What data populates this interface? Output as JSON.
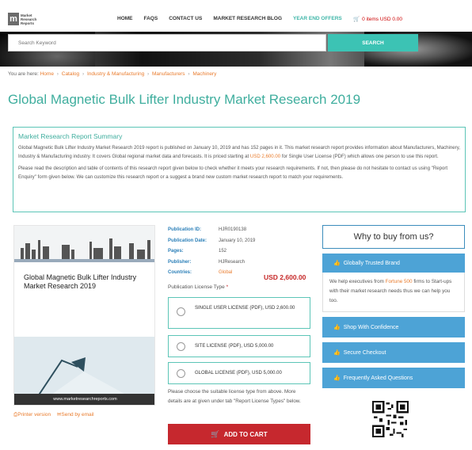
{
  "header": {
    "logo_mark": "m",
    "logo_text_lines": [
      "Market",
      "Research",
      "Reports"
    ],
    "nav": [
      "HOME",
      "FAQS",
      "CONTACT US",
      "MARKET RESEARCH BLOG",
      "YEAR END OFFERS"
    ],
    "cart_label": "0 items USD 0.00"
  },
  "search": {
    "placeholder": "Search Keyword",
    "button_label": "SEARCH"
  },
  "breadcrumb": {
    "prefix": "You are here:",
    "items": [
      "Home",
      "Catalog",
      "Industry & Manufacturing",
      "Manufacturers",
      "Machinery"
    ]
  },
  "page_title": "Global Magnetic Bulk Lifter Industry Market Research 2019",
  "summary": {
    "title": "Market Research Report Summary",
    "para1_a": "Global Magnetic Bulk Lifter Industry Market Research 2019 report is published on January 10, 2019 and has 152 pages in it. This market research report provides information about Manufacturers, Machinery, Industry & Manufacturing industry. It covers Global regional market data and forecasts. It is priced starting at",
    "para1_price": "USD 2,600.00",
    "para1_b": "for Single User License (PDF) which allows one person to use this report.",
    "para2": "Please read the description and table of contents of this research report given below to check whether it meets your research requirements. If not, then please do not hesitate to contact us using \"Report Enquiry\" form given below. We can customize this research report or a suggest a brand new custom market research report to match your requirements."
  },
  "cover": {
    "title": "Global Magnetic Bulk Lifter Industry Market Research 2019",
    "url": "www.marketresearchreports.com"
  },
  "links": {
    "printer": "Printer version",
    "email": "Send by email"
  },
  "publication": {
    "rows": [
      {
        "key": "Publication ID:",
        "value": "HJR0190138"
      },
      {
        "key": "Publication Date:",
        "value": "January 10, 2019"
      },
      {
        "key": "Pages:",
        "value": "152"
      },
      {
        "key": "Publisher:",
        "value": "HJResearch"
      },
      {
        "key": "Countries:",
        "value": "Global"
      }
    ],
    "price": "USD 2,600.00",
    "license_type_label": "Publication License Type",
    "license_required_mark": "*"
  },
  "licenses": [
    {
      "label": "SINGLE USER LICENSE (PDF), USD 2,600.00"
    },
    {
      "label": "SITE LICENSE (PDF), USD 5,000.00"
    },
    {
      "label": "GLOBAL LICENSE (PDF), USD 5,000.00"
    }
  ],
  "license_note": "Please choose the suitable license type from above. More details are at given under tab \"Report License Types\" below.",
  "add_to_cart_label": "ADD TO CART",
  "sidebar": {
    "why_title": "Why to buy from us?",
    "trusted_label": "Globally Trusted Brand",
    "trusted_body_a": "We help executives from",
    "trusted_body_hl": "Fortune 500",
    "trusted_body_b": "firms to Start-ups with their market research needs thus we can help you too.",
    "shop_label": "Shop With Confidence",
    "secure_label": "Secure Checkout",
    "faq_label": "Frequently Asked Questions"
  },
  "colors": {
    "accent_teal": "#3fae9e",
    "link_orange": "#e97b2c",
    "cart_red": "#c6282e",
    "sidebar_blue": "#4da3d6"
  }
}
